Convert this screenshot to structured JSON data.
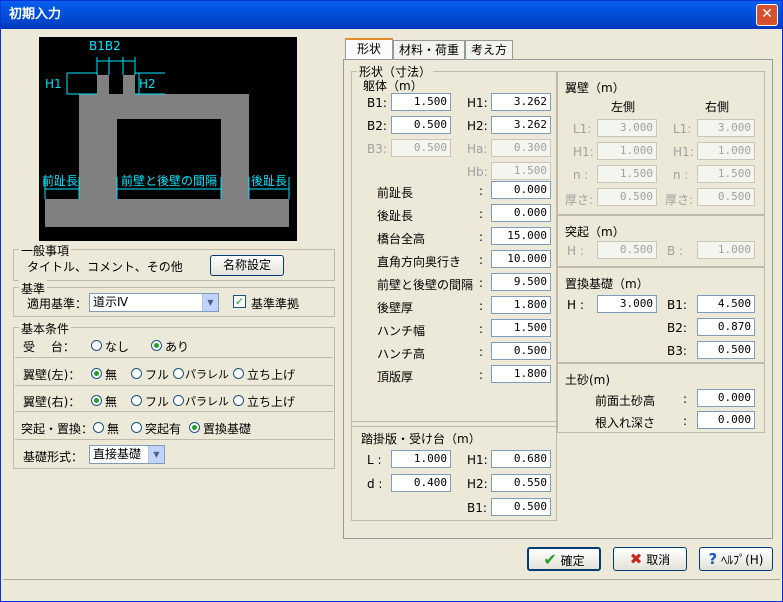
{
  "window": {
    "title": "初期入力"
  },
  "diagram": {
    "b1b2": "B1B2",
    "h1": "H1",
    "h2": "H2",
    "front_toe": "前趾長",
    "wall_spacing": "前壁と後壁の間隔",
    "back_toe": "後趾長"
  },
  "general": {
    "title": "一般事項",
    "text": "タイトル、コメント、その他",
    "name_button": "名称設定"
  },
  "standard": {
    "title": "基準",
    "label": "適用基準：",
    "value": "道示Ⅳ",
    "check_label": "基準準拠"
  },
  "basic": {
    "title": "基本条件",
    "abutment_label": "受　 台：",
    "opt_none": "なし",
    "opt_yes": "あり",
    "wing_left_label": "翼壁(左)：",
    "wing_right_label": "翼壁(右)：",
    "wing_opts": [
      "無",
      "フル",
      "パラレル",
      "立ち上げ"
    ],
    "protrusion_label": "突起・置換：",
    "protrusion_opts": [
      "無",
      "突起有",
      "置換基礎"
    ],
    "foundation_label": "基礎形式：",
    "foundation_value": "直接基礎"
  },
  "tabs": [
    "形状",
    "材料・荷重",
    "考え方"
  ],
  "shape": {
    "group_title": "形状（寸法）",
    "body_title": "躯体（m）",
    "B1": {
      "label": "B1:",
      "value": "1.500"
    },
    "B2": {
      "label": "B2:",
      "value": "0.500"
    },
    "B3": {
      "label": "B3:",
      "value": "0.500"
    },
    "H1": {
      "label": "H1:",
      "value": "3.262"
    },
    "H2": {
      "label": "H2:",
      "value": "3.262"
    },
    "Ha": {
      "label": "Ha:",
      "value": "0.300"
    },
    "Hb": {
      "label": "Hb:",
      "value": "1.500"
    },
    "rows": [
      {
        "label": "前趾長",
        "value": "0.000"
      },
      {
        "label": "後趾長",
        "value": "0.000"
      },
      {
        "label": "橋台全高",
        "value": "15.000"
      },
      {
        "label": "直角方向奥行き",
        "value": "10.000"
      },
      {
        "label": "前壁と後壁の間隔",
        "value": "9.500"
      },
      {
        "label": "後壁厚",
        "value": "1.800"
      },
      {
        "label": "ハンチ幅",
        "value": "1.500"
      },
      {
        "label": "ハンチ高",
        "value": "0.500"
      },
      {
        "label": "頂版厚",
        "value": "1.800"
      }
    ],
    "colon": ":"
  },
  "approach": {
    "title": "踏掛版・受け台（m）",
    "L": {
      "label": "L :",
      "value": "1.000"
    },
    "d": {
      "label": "d :",
      "value": "0.400"
    },
    "H1": {
      "label": "H1:",
      "value": "0.680"
    },
    "H2": {
      "label": "H2:",
      "value": "0.550"
    },
    "B1": {
      "label": "B1:",
      "value": "0.500"
    }
  },
  "wing": {
    "title": "翼壁（m）",
    "left": "左側",
    "right": "右側",
    "labels": [
      "L1:",
      "H1:",
      "n :",
      "厚さ:"
    ],
    "left_values": [
      "3.000",
      "1.000",
      "1.500",
      "0.500"
    ],
    "right_values": [
      "3.000",
      "1.000",
      "1.500",
      "0.500"
    ]
  },
  "protrusion": {
    "title": "突起（m）",
    "H": {
      "label": "H :",
      "value": "0.500"
    },
    "B": {
      "label": "B :",
      "value": "1.000"
    }
  },
  "replace": {
    "title": "置換基礎（m）",
    "H": {
      "label": "H :",
      "value": "3.000"
    },
    "B1": {
      "label": "B1:",
      "value": "4.500"
    },
    "B2": {
      "label": "B2:",
      "value": "0.870"
    },
    "B3": {
      "label": "B3:",
      "value": "0.500"
    }
  },
  "soil": {
    "title": "土砂(m)",
    "front": {
      "label": "前面土砂高",
      "value": "0.000"
    },
    "embed": {
      "label": "根入れ深さ",
      "value": "0.000"
    },
    "colon": ":"
  },
  "buttons": {
    "ok": "確定",
    "cancel": "取消",
    "help": "ﾍﾙﾌﾟ(H)"
  }
}
